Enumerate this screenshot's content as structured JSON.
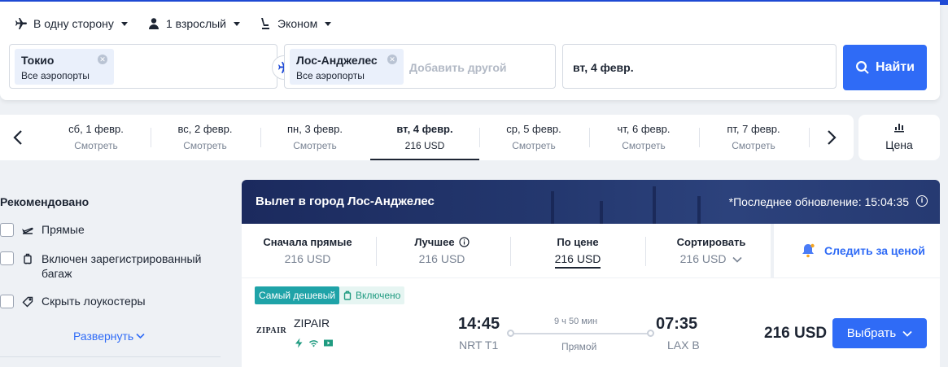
{
  "search": {
    "trip_type": "В одну сторону",
    "passengers": "1 взрослый",
    "cabin": "Эконом",
    "origin": {
      "city": "Токио",
      "airports": "Все аэропорты"
    },
    "destination": {
      "city": "Лос-Анджелес",
      "airports": "Все аэропорты"
    },
    "add_other_placeholder": "Добавить другой",
    "date": "вт, 4 февр.",
    "find_label": "Найти"
  },
  "date_strip": {
    "days": [
      {
        "date": "сб, 1 февр.",
        "price": "Смотреть"
      },
      {
        "date": "вс, 2 февр.",
        "price": "Смотреть"
      },
      {
        "date": "пн, 3 февр.",
        "price": "Смотреть"
      },
      {
        "date": "вт, 4 февр.",
        "price": "216 USD"
      },
      {
        "date": "ср, 5 февр.",
        "price": "Смотреть"
      },
      {
        "date": "чт, 6 февр.",
        "price": "Смотреть"
      },
      {
        "date": "пт, 7 февр.",
        "price": "Смотреть"
      }
    ],
    "active_index": 3,
    "price_toggle_label": "Цена"
  },
  "filters": {
    "title": "Рекомендовано",
    "items": [
      {
        "label": "Прямые",
        "icon": "plane-icon"
      },
      {
        "label": "Включен зарегистрированный багаж",
        "icon": "luggage-icon"
      },
      {
        "label": "Скрыть лоукостеры",
        "icon": "tag-icon"
      }
    ],
    "expand_label": "Развернуть"
  },
  "results": {
    "banner_title": "Вылет в город Лос-Анджелес",
    "last_update": "*Последнее обновление: 15:04:35",
    "sorts": [
      {
        "label": "Сначала прямые",
        "value": "216 USD"
      },
      {
        "label": "Лучшее",
        "value": "216 USD"
      },
      {
        "label": "По цене",
        "value": "216 USD"
      },
      {
        "label": "Сортировать",
        "value": "216 USD"
      }
    ],
    "active_sort": 2,
    "watch_label": "Следить за ценой",
    "flight": {
      "badge_cheapest": "Самый дешевый",
      "badge_included": "Включено",
      "airline_logo": "ZIPAIR",
      "airline": "ZIPAIR",
      "depart_time": "14:45",
      "depart_airport": "NRT T1",
      "duration": "9 ч 50 мин",
      "stops": "Прямой",
      "arrive_time": "07:35",
      "arrive_airport": "LAX B",
      "price": "216 USD",
      "choose_label": "Выбрать"
    }
  },
  "colors": {
    "accent": "#2f6bf6",
    "banner": "#1b2a5e",
    "badge_cheapest": "#1fa3a8",
    "badge_included": "#1f9b80"
  }
}
